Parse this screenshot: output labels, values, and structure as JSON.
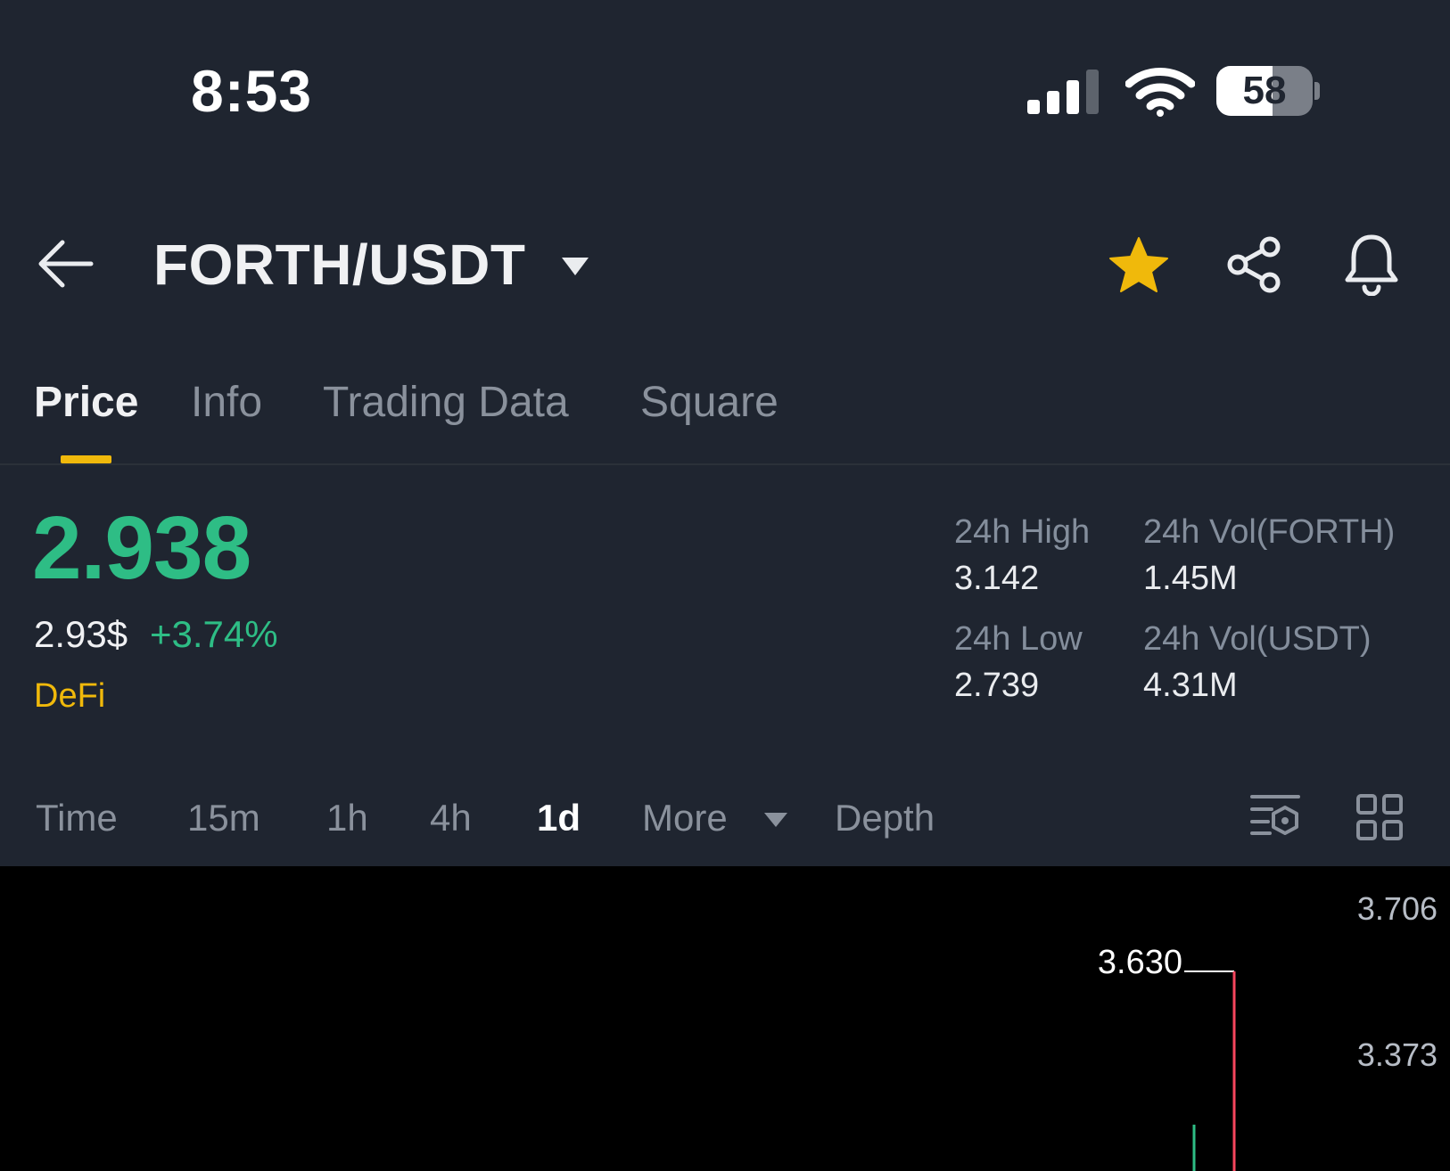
{
  "status_bar": {
    "time": "8:53",
    "battery_level": "58",
    "battery_fraction": 0.58
  },
  "header": {
    "pair": "FORTH/USDT",
    "favorite_color": "#f0b90b"
  },
  "tabs": [
    {
      "label": "Price",
      "active": true
    },
    {
      "label": "Info",
      "active": false
    },
    {
      "label": "Trading Data",
      "active": false
    },
    {
      "label": "Square",
      "active": false
    }
  ],
  "ticker": {
    "last_price": "2.938",
    "usd_price": "2.93$",
    "change_pct": "+3.74%",
    "tag": "DeFi",
    "stats": {
      "high_label": "24h High",
      "high_value": "3.142",
      "low_label": "24h Low",
      "low_value": "2.739",
      "vol_base_label": "24h Vol(FORTH)",
      "vol_base_value": "1.45M",
      "vol_quote_label": "24h Vol(USDT)",
      "vol_quote_value": "4.31M"
    }
  },
  "intervals": {
    "items": [
      {
        "label": "Time",
        "active": false
      },
      {
        "label": "15m",
        "active": false
      },
      {
        "label": "1h",
        "active": false
      },
      {
        "label": "4h",
        "active": false
      },
      {
        "label": "1d",
        "active": true
      },
      {
        "label": "More",
        "active": false
      },
      {
        "label": "Depth",
        "active": false
      }
    ]
  },
  "colors": {
    "up": "#2ebd85",
    "down": "#f6465d",
    "accent": "#f0b90b",
    "background": "#1f2530"
  },
  "icons": {
    "back": "arrow-left-icon",
    "dropdown": "caret-down-icon",
    "favorite": "star-icon",
    "share": "share-icon",
    "alert": "bell-icon",
    "indicators": "indicator-settings-icon",
    "layout": "grid-icon"
  },
  "chart_data": {
    "type": "candlestick",
    "y_ticks": [
      "3.706",
      "3.373"
    ],
    "high_marker": "3.630"
  }
}
